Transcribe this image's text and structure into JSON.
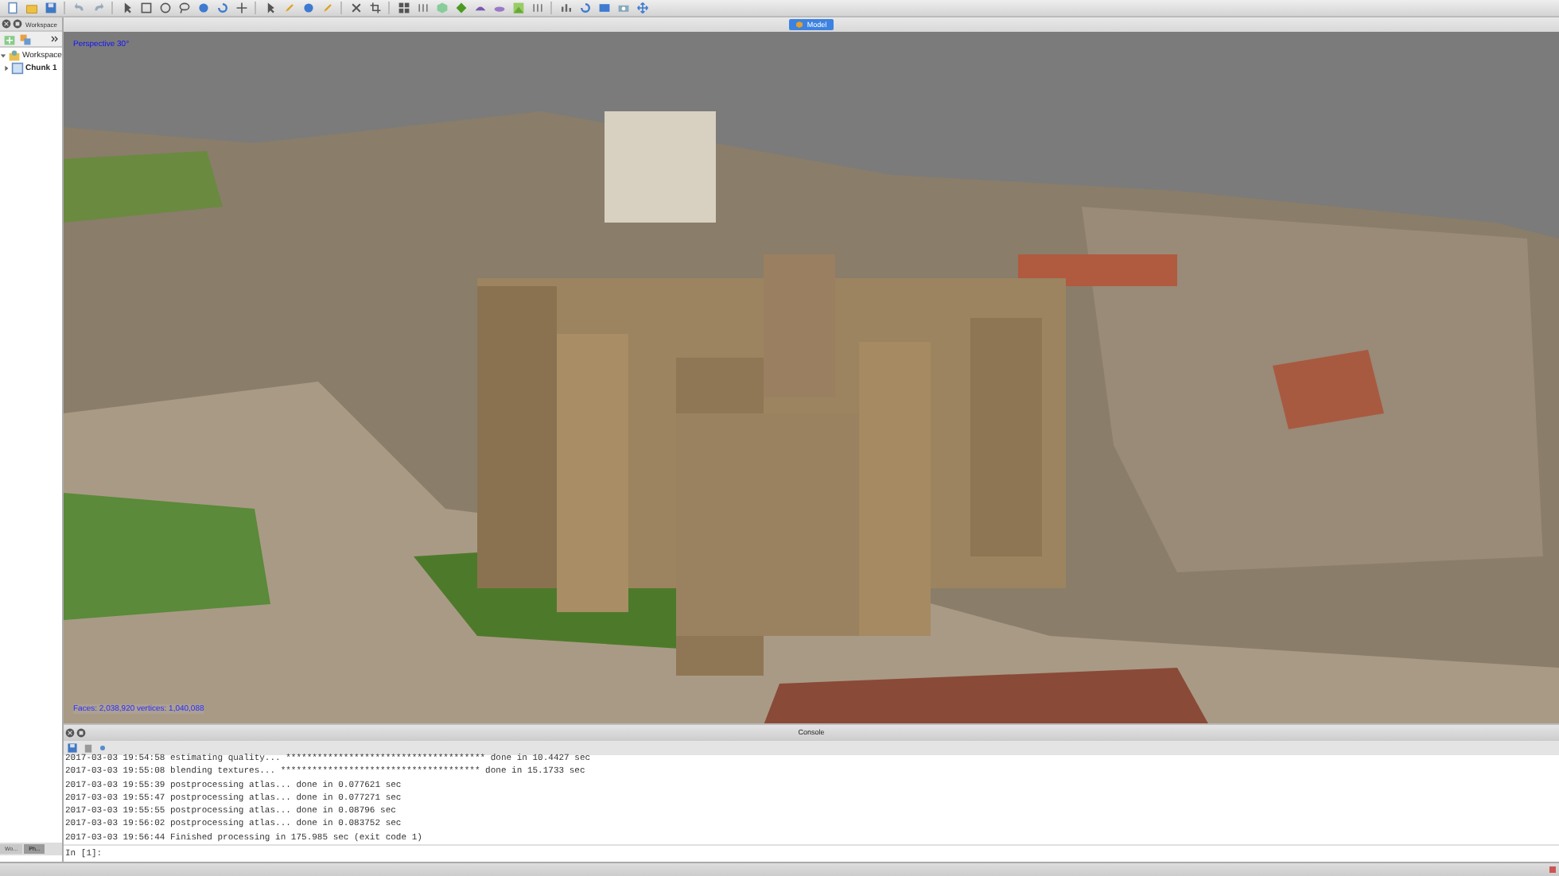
{
  "workspace_panel": {
    "title": "Workspace",
    "tree": [
      {
        "label": "Workspace",
        "expanded": true,
        "children": [
          {
            "label": "Chunk 1",
            "expanded": false
          }
        ]
      }
    ],
    "tabs": [
      {
        "label": "Wo...",
        "selected": false
      },
      {
        "label": "Ph...",
        "selected": true
      }
    ]
  },
  "model_view": {
    "tabs": [
      {
        "label": "Model",
        "selected": true
      }
    ],
    "projection": "Perspective 30°",
    "stats": "Faces: 2,038,920 vertices: 1,040,088"
  },
  "console": {
    "title": "Console",
    "lines": [
      "2017-03-03 19:54:58 estimating quality... ************************************** done in 10.4427 sec",
      "2017-03-03 19:55:08 blending textures... ************************************** done in 15.1733 sec",
      "2017-03-03 19:55:39 postprocessing atlas... done in 0.077621 sec",
      "2017-03-03 19:55:47 postprocessing atlas... done in 0.077271 sec",
      "2017-03-03 19:55:55 postprocessing atlas... done in 0.08796 sec",
      "2017-03-03 19:56:02 postprocessing atlas... done in 0.083752 sec",
      "2017-03-03 19:56:44 Finished processing in 175.985 sec (exit code 1)"
    ],
    "prompt": "In [1]:"
  }
}
